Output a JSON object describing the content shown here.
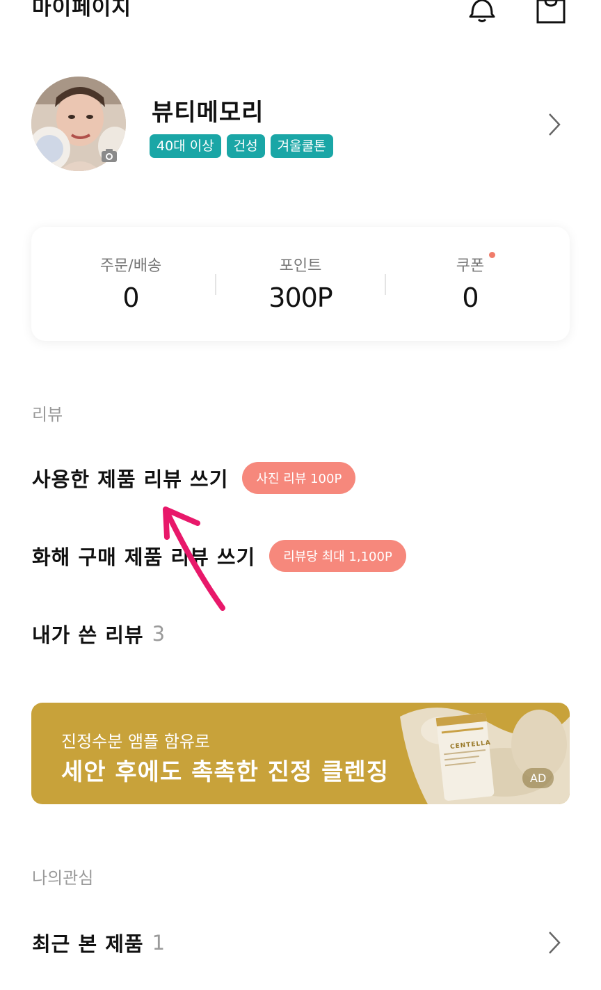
{
  "header": {
    "title": "마이페이지",
    "bell_icon": "bell-icon",
    "bag_icon": "shopping-bag-icon"
  },
  "profile": {
    "username": "뷰티메모리",
    "tags": [
      "40대 이상",
      "건성",
      "겨울쿨톤"
    ],
    "camera_icon": "camera-icon"
  },
  "stats": {
    "orders": {
      "label": "주문/배송",
      "value": "0"
    },
    "points": {
      "label": "포인트",
      "value": "300P"
    },
    "coupons": {
      "label": "쿠폰",
      "value": "0",
      "has_new": true
    }
  },
  "review_section": {
    "label": "리뷰",
    "items": [
      {
        "label": "사용한 제품 리뷰 쓰기",
        "pill": "사진 리뷰 100P"
      },
      {
        "label": "화해 구매 제품 리뷰 쓰기",
        "pill": "리뷰당 최대 1,100P"
      },
      {
        "label": "내가 쓴 리뷰",
        "count": "3"
      }
    ]
  },
  "ad_banner": {
    "subtitle": "진정수분 앰플 함유로",
    "title": "세안 후에도 촉촉한 진정 클렌징",
    "badge": "AD",
    "product_text": "CENTELLA"
  },
  "interest_section": {
    "label": "나의관심",
    "items": [
      {
        "label": "최근 본 제품",
        "count": "1"
      }
    ]
  },
  "colors": {
    "teal_tag": "#1aa6a6",
    "coral_pill": "#f6887c",
    "banner_gold": "#c8a23a",
    "annotation_pink": "#e8186a"
  }
}
